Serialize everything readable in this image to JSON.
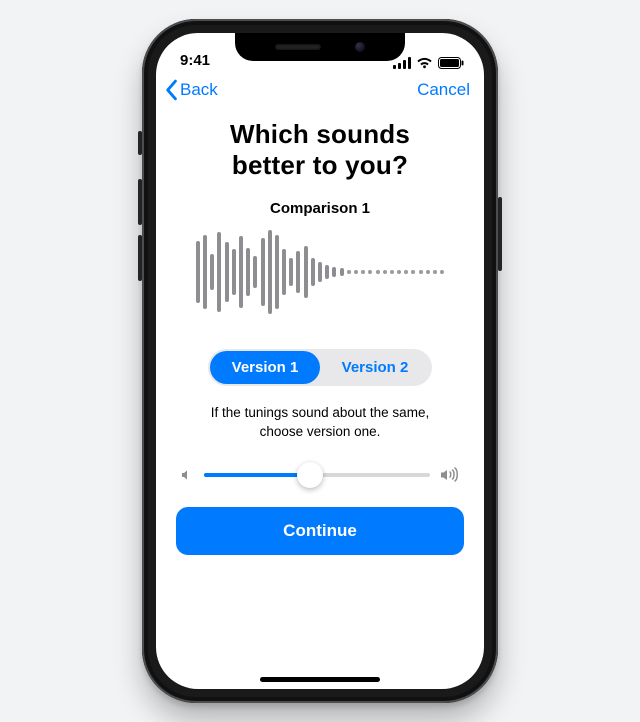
{
  "status": {
    "time": "9:41"
  },
  "nav": {
    "back": "Back",
    "cancel": "Cancel"
  },
  "title_line1": "Which sounds",
  "title_line2": "better to you?",
  "comparison_label": "Comparison 1",
  "waveform_bars": [
    62,
    74,
    36,
    80,
    60,
    46,
    72,
    48,
    32,
    68,
    84,
    74,
    46,
    28,
    42,
    52,
    28,
    20,
    14,
    10,
    8
  ],
  "waveform_dots": 14,
  "segments": {
    "a": "Version 1",
    "b": "Version 2",
    "selected": "a"
  },
  "hint_line1": "If the tunings sound about the same,",
  "hint_line2": "choose version one.",
  "volume_percent": 47,
  "continue_label": "Continue",
  "colors": {
    "accent": "#007aff"
  }
}
